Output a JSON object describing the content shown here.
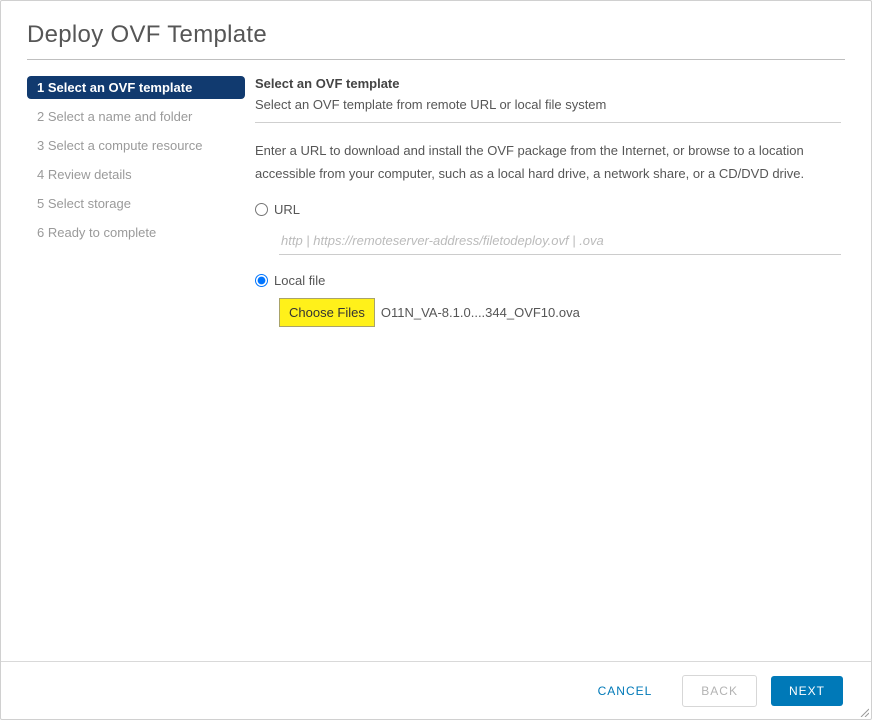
{
  "dialog": {
    "title": "Deploy OVF Template"
  },
  "steps": [
    {
      "label": "1 Select an OVF template",
      "active": true
    },
    {
      "label": "2 Select a name and folder",
      "active": false
    },
    {
      "label": "3 Select a compute resource",
      "active": false
    },
    {
      "label": "4 Review details",
      "active": false
    },
    {
      "label": "5 Select storage",
      "active": false
    },
    {
      "label": "6 Ready to complete",
      "active": false
    }
  ],
  "main": {
    "heading": "Select an OVF template",
    "subheading": "Select an OVF template from remote URL or local file system",
    "description": "Enter a URL to download and install the OVF package from the Internet, or browse to a location accessible from your computer, such as a local hard drive, a network share, or a CD/DVD drive.",
    "url": {
      "label": "URL",
      "placeholder": "http | https://remoteserver-address/filetodeploy.ovf | .ova",
      "selected": false
    },
    "localFile": {
      "label": "Local file",
      "chooseLabel": "Choose Files",
      "filename": "O11N_VA-8.1.0....344_OVF10.ova",
      "selected": true
    }
  },
  "footer": {
    "cancel": "CANCEL",
    "back": "BACK",
    "next": "NEXT"
  }
}
